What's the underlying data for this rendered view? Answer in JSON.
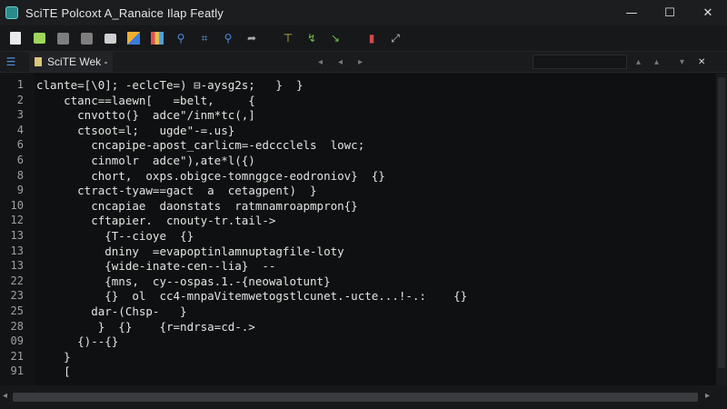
{
  "window": {
    "title": "SciTE  Polcoxt  A_Ranaice  Ilap  Featly",
    "minimize": "—",
    "maximize": "☐",
    "close": "✕"
  },
  "toolbar": {
    "icons": [
      "new-file-icon",
      "open-file-icon",
      "save-icon",
      "folder-icon",
      "print-icon",
      "color-icon",
      "stack-icon",
      "search-user-icon",
      "grid-icon",
      "find-icon",
      "arrow-icon",
      "build-icon",
      "go-icon",
      "stop-icon",
      "chart-icon",
      "wand-icon"
    ]
  },
  "tabs": {
    "active_label": "SciTE We⁠k -",
    "list_icon": "☰",
    "nav_left": "◂",
    "nav_prev": "◂",
    "nav_next": "▸",
    "nav_up": "▴",
    "nav_down": "▾",
    "close": "✕"
  },
  "editor": {
    "lines": [
      {
        "n": "1",
        "code": "clante=[\\0]; -eclcTe=) ⊟-aysg2s;   }  }"
      },
      {
        "n": "2",
        "code": "    ctanc==laewn[   =belt,     {"
      },
      {
        "n": "3",
        "code": "      cnvotto(}  adce\"/inm*tc(,]"
      },
      {
        "n": "4",
        "code": "      ctsoot=l;   ugde\"-=.us}"
      },
      {
        "n": "6",
        "code": "        cncapipe-apost_carlicm=-edccclels  lowc;"
      },
      {
        "n": "6",
        "code": "        cinmolr  adce\"),ate*l({)"
      },
      {
        "n": "8",
        "code": "        chort,  oxps.obigce-tomnggce-eodroniov}  {}"
      },
      {
        "n": "9",
        "code": "      ctract-tyaw==gact  a  cetagpent)  }"
      },
      {
        "n": "10",
        "code": "        cncapiae  daonstats  ratmnamroapmpron{}"
      },
      {
        "n": "12",
        "code": "        cftapier.  cnouty-tr.tail->"
      },
      {
        "n": "13",
        "code": "          {T--cioye  {}"
      },
      {
        "n": "13",
        "code": "          dniny  =evapoptinlamnuptagfile-loty"
      },
      {
        "n": "13",
        "code": "          {wide-inate-cen--lia}  -- "
      },
      {
        "n": "22",
        "code": "          {mns,  cy--ospas.1.-{neowalotunt}"
      },
      {
        "n": "23",
        "code": "          {}  ol  cc4-mnpaVitemwetogstlcunet.-ucte...!-.:    {}"
      },
      {
        "n": "25",
        "code": "        dar-(Chsp-   }"
      },
      {
        "n": "28",
        "code": "         }  {}    {r=ndrsa=cd-.>"
      },
      {
        "n": "09",
        "code": "      {)--{}"
      },
      {
        "n": "21",
        "code": "    }"
      },
      {
        "n": "91",
        "code": "    ["
      }
    ]
  },
  "scrollbar": {
    "left_arrow": "◂",
    "right_arrow": "▸"
  }
}
